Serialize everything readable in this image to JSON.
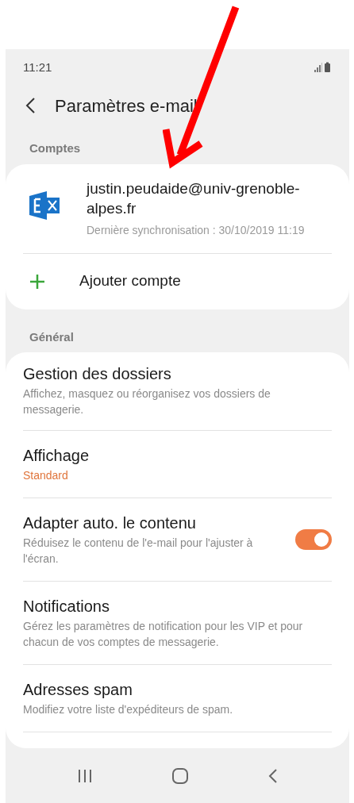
{
  "status_bar": {
    "time": "11:21"
  },
  "header": {
    "title": "Paramètres e-mail"
  },
  "sections": [
    {
      "heading": "Comptes",
      "kind": "accounts",
      "account": {
        "email": "justin.peudaide@univ-grenoble-alpes.fr",
        "sync": "Dernière synchronisation : 30/10/2019 11:19"
      },
      "add_label": "Ajouter compte"
    },
    {
      "heading": "Général",
      "kind": "settings",
      "items": [
        {
          "kind": "link",
          "title": "Gestion des dossiers",
          "subtitle": "Affichez, masquez ou réorganisez vos dossiers de messagerie."
        },
        {
          "kind": "value",
          "title": "Affichage",
          "value": "Standard"
        },
        {
          "kind": "toggle",
          "title": "Adapter auto. le contenu",
          "subtitle": "Réduisez le contenu de l'e-mail pour l'ajuster à l'écran.",
          "on": true
        },
        {
          "kind": "link",
          "title": "Notifications",
          "subtitle": "Gérez les paramètres de notification pour les VIP et pour chacun de vos comptes de messagerie."
        },
        {
          "kind": "link",
          "title": "Adresses spam",
          "subtitle": "Modifiez votre liste d'expéditeurs de spam."
        }
      ]
    }
  ]
}
